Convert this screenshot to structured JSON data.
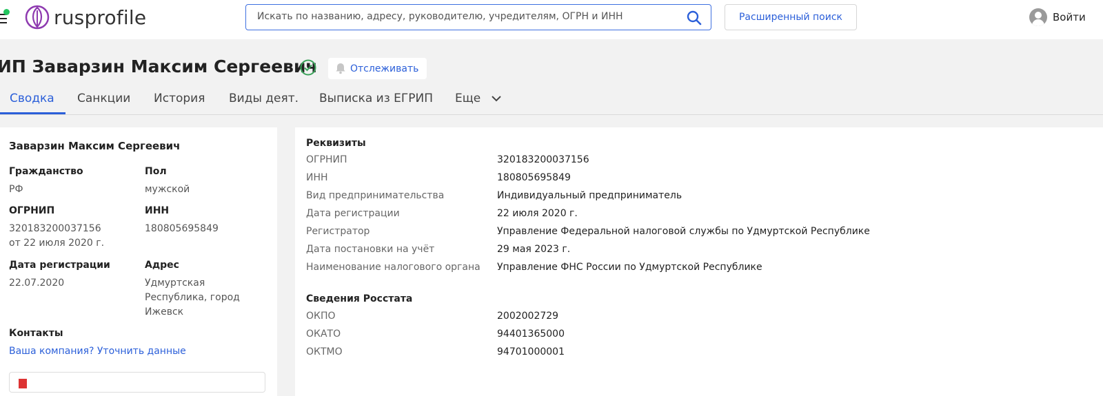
{
  "header": {
    "logo_text": "rusprofile",
    "search_placeholder": "Искать по названию, адресу, руководителю, учредителям, ОГРН и ИНН",
    "advanced_search": "Расширенный поиск",
    "login": "Войти"
  },
  "page": {
    "title": "ИП Заварзин Максим Сергеевич",
    "track_label": "Отслеживать"
  },
  "tabs": [
    {
      "label": "Сводка"
    },
    {
      "label": "Санкции"
    },
    {
      "label": "История"
    },
    {
      "label": "Виды деят."
    },
    {
      "label": "Выписка из ЕГРИП"
    },
    {
      "label": "Еще"
    }
  ],
  "summary": {
    "name": "Заварзин Максим Сергеевич",
    "citizenship_label": "Гражданство",
    "citizenship_value": "РФ",
    "gender_label": "Пол",
    "gender_value": "мужской",
    "ogrnip_label": "ОГРНИП",
    "ogrnip_value": "320183200037156",
    "ogrnip_date": "от 22 июля 2020 г.",
    "inn_label": "ИНН",
    "inn_value": "180805695849",
    "reg_date_label": "Дата регистрации",
    "reg_date_value": "22.07.2020",
    "address_label": "Адрес",
    "address_line1": "Удмуртская",
    "address_line2": "Республика, город",
    "address_line3": "Ижевск",
    "contacts_label": "Контакты",
    "contacts_link": "Ваша компания? Уточнить данные"
  },
  "requisites": {
    "title": "Реквизиты",
    "rows": [
      {
        "label": "ОГРНИП",
        "value": "320183200037156"
      },
      {
        "label": "ИНН",
        "value": "180805695849"
      },
      {
        "label": "Вид предпринимательства",
        "value": "Индивидуальный предприниматель"
      },
      {
        "label": "Дата регистрации",
        "value": "22 июля 2020 г."
      },
      {
        "label": "Регистратор",
        "value": "Управление Федеральной налоговой службы по Удмуртской Республике"
      },
      {
        "label": "Дата постановки на учёт",
        "value": "29 мая 2023 г."
      },
      {
        "label": "Наименование налогового органа",
        "value": "Управление ФНС России по Удмуртской Республике"
      }
    ]
  },
  "rosstat": {
    "title": "Сведения Росстата",
    "rows": [
      {
        "label": "ОКПО",
        "value": "2002002729"
      },
      {
        "label": "ОКАТО",
        "value": "94401365000"
      },
      {
        "label": "ОКТМО",
        "value": "94701000001"
      }
    ]
  },
  "colors": {
    "accent": "#2b5fd9",
    "verified": "#3aa35a",
    "status_dot": "#22c55e"
  }
}
